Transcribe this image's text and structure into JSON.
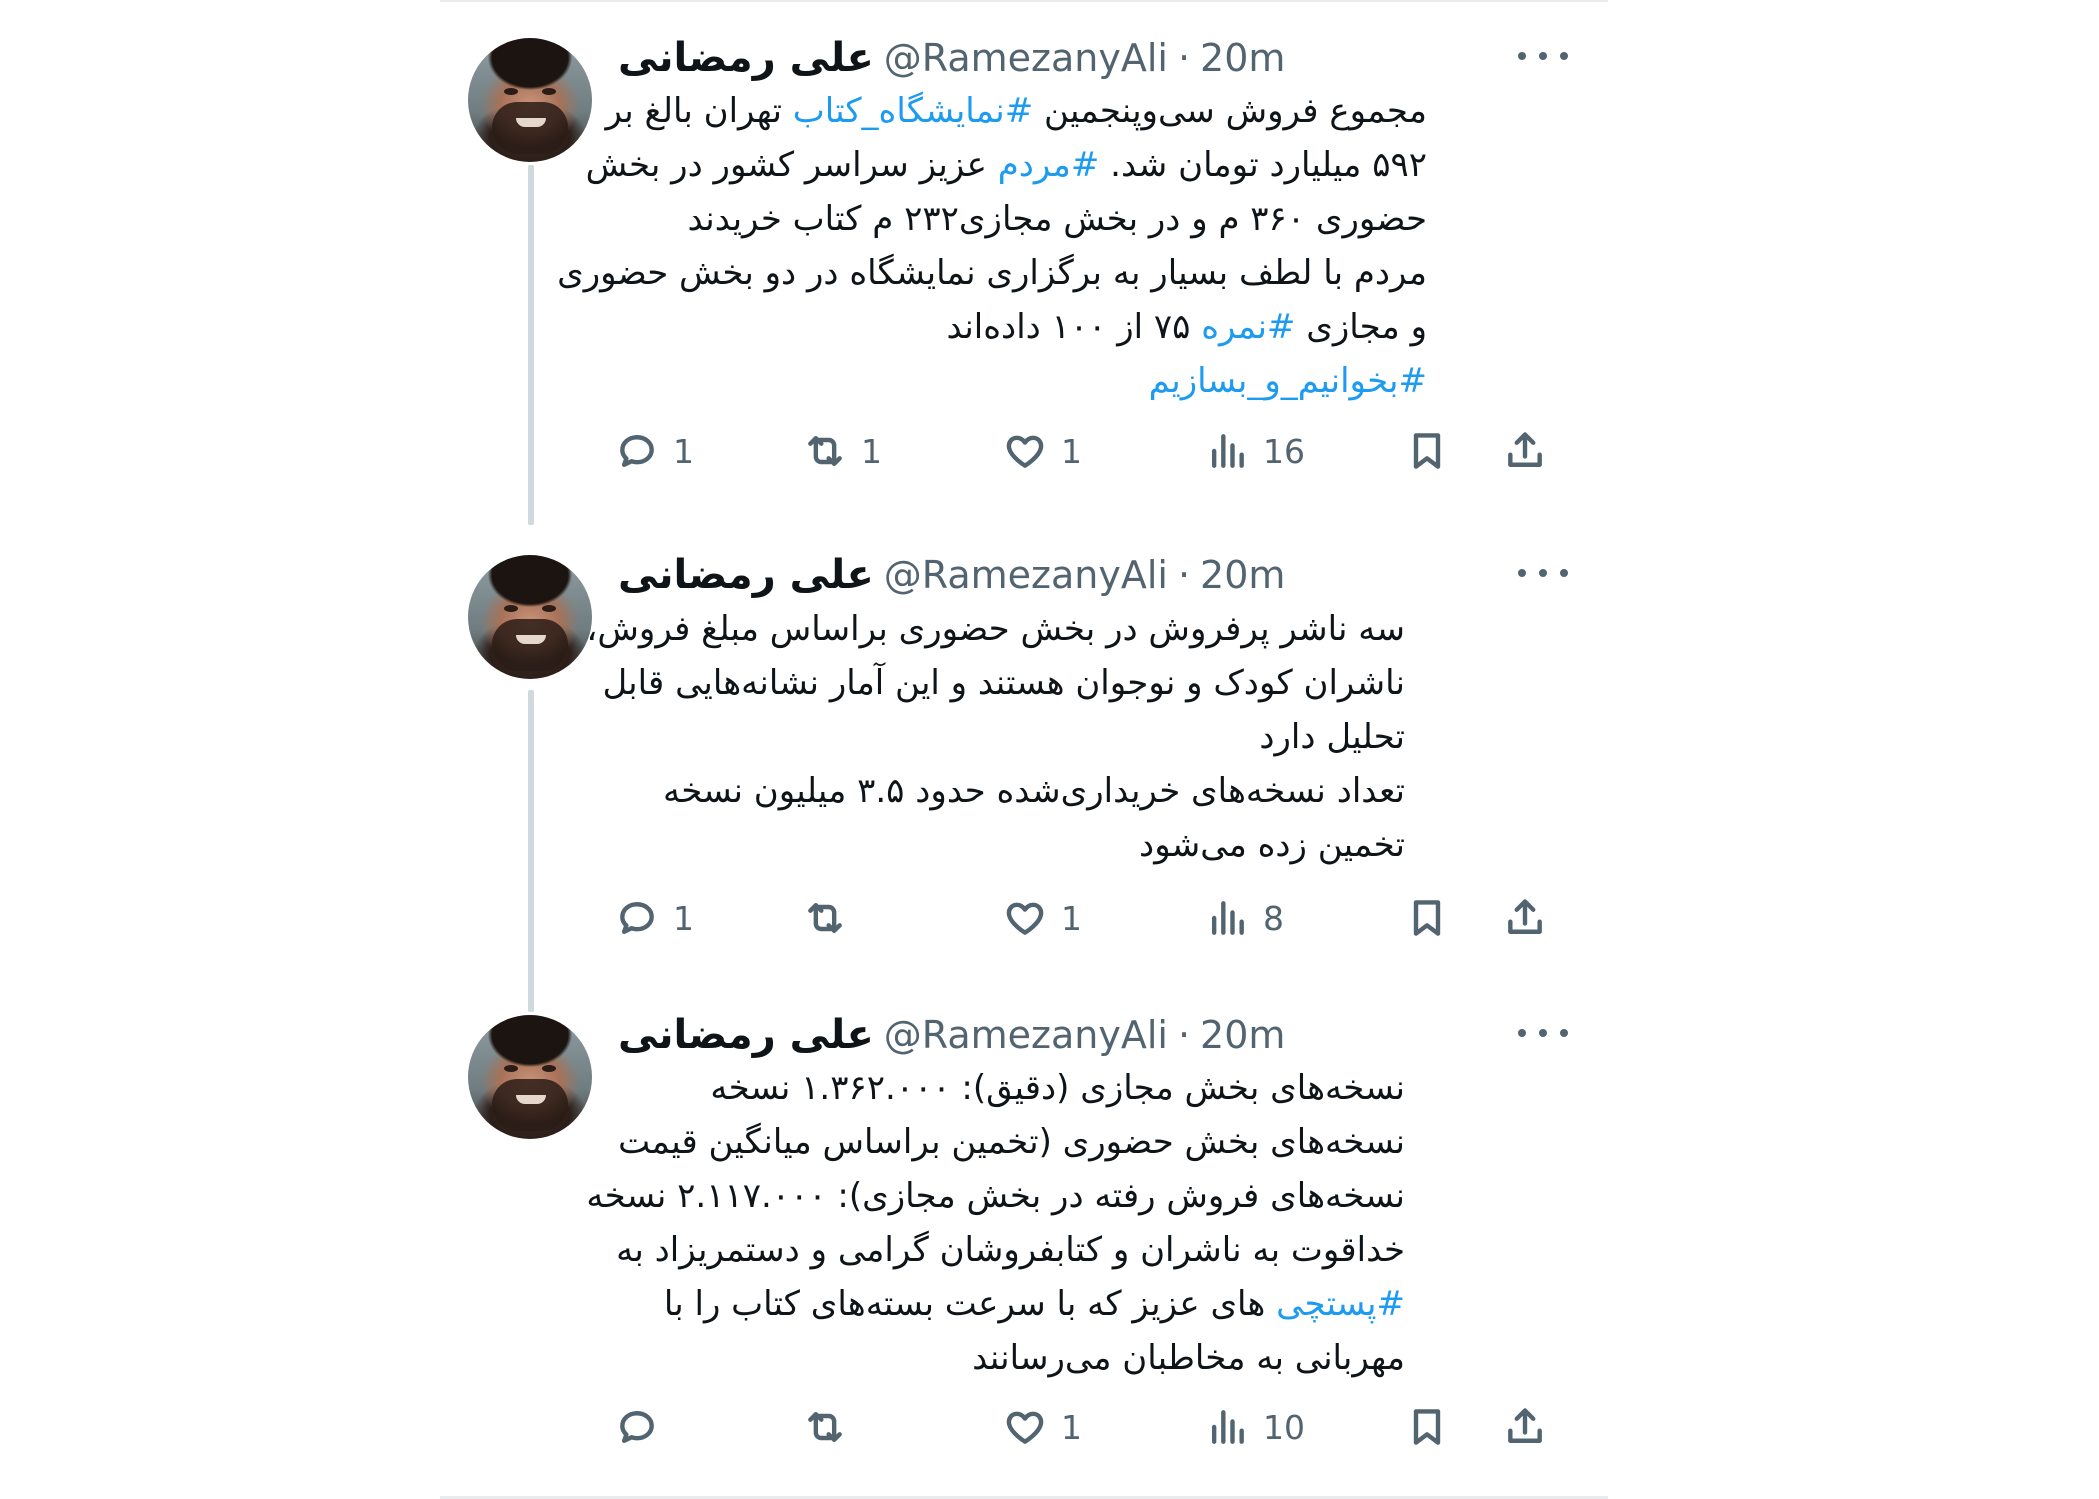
{
  "tweets": [
    {
      "author_name": "علی رمضانی",
      "handle": "@RamezanyAli",
      "separator": "·",
      "time": "20m",
      "lines": [
        [
          {
            "t": "مجموع فروش سی‌وپنجمین "
          },
          {
            "t": "#نمایشگاه_کتاب",
            "tag": true
          },
          {
            "t": " تهران بالغ بر"
          }
        ],
        [
          {
            "t": "۵۹۲ میلیارد تومان شد. "
          },
          {
            "t": "#مردم",
            "tag": true
          },
          {
            "t": " عزیز سراسر کشور در بخش"
          }
        ],
        [
          {
            "t": "حضوری ۳۶۰ م و در بخش مجازی۲۳۲ م کتاب خریدند"
          }
        ],
        [
          {
            "t": "مردم با لطف بسیار به برگزاری نمایشگاه در دو بخش حضوری"
          }
        ],
        [
          {
            "t": "و مجازی "
          },
          {
            "t": "#نمره",
            "tag": true
          },
          {
            "t": " ۷۵  از ۱۰۰ داده‌اند"
          }
        ],
        [
          {
            "t": "#بخوانیم_و_بسازیم",
            "tag": true
          }
        ]
      ],
      "replies": "1",
      "retweets": "1",
      "likes": "1",
      "views": "16"
    },
    {
      "author_name": "علی رمضانی",
      "handle": "@RamezanyAli",
      "separator": "·",
      "time": "20m",
      "lines": [
        [
          {
            "t": "سه ناشر پرفروش در بخش حضوری براساس مبلغ فروش،"
          }
        ],
        [
          {
            "t": "ناشران کودک و نوجوان هستند و این آمار نشانه‌هایی قابل"
          }
        ],
        [
          {
            "t": "تحلیل دارد"
          }
        ],
        [
          {
            "t": "تعداد نسخه‌های خریداری‌شده حدود ۳.۵ میلیون نسخه"
          }
        ],
        [
          {
            "t": "تخمین زده می‌شود"
          }
        ]
      ],
      "replies": "1",
      "retweets": "",
      "likes": "1",
      "views": "8"
    },
    {
      "author_name": "علی رمضانی",
      "handle": "@RamezanyAli",
      "separator": "·",
      "time": "20m",
      "lines": [
        [
          {
            "t": "نسخه‌های بخش مجازی (دقیق): ۱.۳۶۲.۰۰۰ نسخه"
          }
        ],
        [
          {
            "t": "نسخه‌های بخش حضوری (تخمین براساس میانگین قیمت"
          }
        ],
        [
          {
            "t": "نسخه‌های فروش رفته در بخش مجازی): ۲.۱۱۷.۰۰۰ نسخه"
          }
        ],
        [
          {
            "t": "خداقوت به ناشران و کتابفروشان گرامی و دستمریزاد به"
          }
        ],
        [
          {
            "t": "#پستچی",
            "tag": true
          },
          {
            "t": " های عزیز که با سرعت بسته‌های کتاب را با"
          }
        ],
        [
          {
            "t": "مهربانی به مخاطبان می‌رسانند"
          }
        ]
      ],
      "replies": "",
      "retweets": "",
      "likes": "1",
      "views": "10"
    }
  ],
  "icons": [
    "reply-icon",
    "retweet-icon",
    "like-icon",
    "views-icon",
    "bookmark-icon",
    "share-icon",
    "more-icon"
  ],
  "colors": {
    "hashtag": "#1d9bf0",
    "text": "#0f1419",
    "secondary": "#536471",
    "thread_line": "#cfd9de"
  }
}
